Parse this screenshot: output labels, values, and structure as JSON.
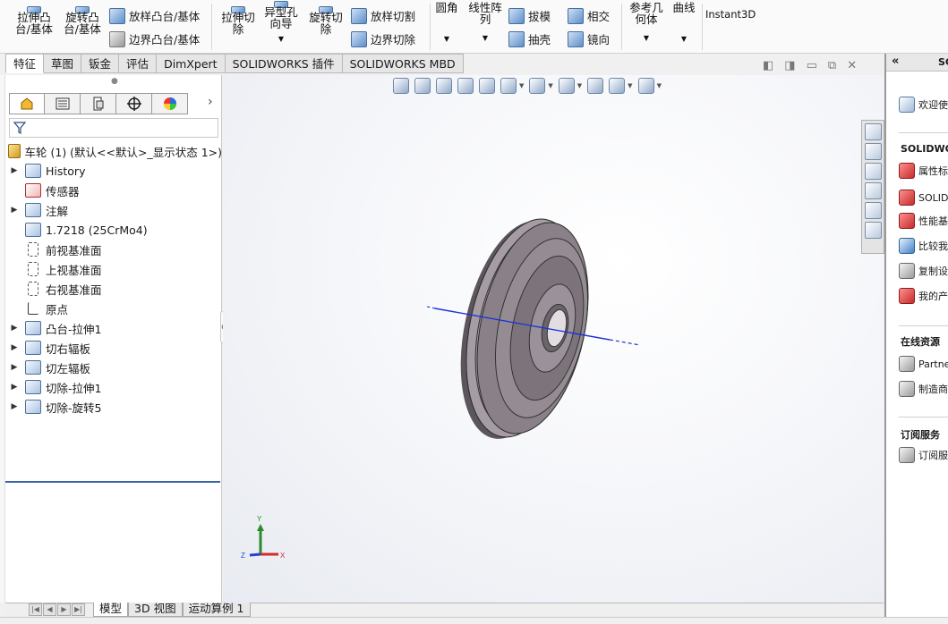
{
  "ribbon": {
    "extrude_boss_l1": "拉伸凸",
    "extrude_boss_l2": "台/基体",
    "revolve_boss_l1": "旋转凸",
    "revolve_boss_l2": "台/基体",
    "loft_boss": "放样凸台/基体",
    "boundary_boss": "边界凸台/基体",
    "extrude_cut_l1": "拉伸切",
    "extrude_cut_l2": "除",
    "hole_wizard_l1": "异型孔",
    "hole_wizard_l2": "向导",
    "revolve_cut_l1": "旋转切",
    "revolve_cut_l2": "除",
    "lofted_cut": "放样切割",
    "boundary_cut": "边界切除",
    "fillet": "圆角",
    "linear_pattern_l1": "线性阵",
    "linear_pattern_l2": "列",
    "draft": "拔模",
    "shell": "抽壳",
    "intersect": "相交",
    "mirror": "镜向",
    "ref_geometry_l1": "参考几",
    "ref_geometry_l2": "何体",
    "curves": "曲线",
    "instant3d": "Instant3D"
  },
  "command_tabs": [
    "特征",
    "草图",
    "钣金",
    "评估",
    "DimXpert",
    "SOLIDWORKS 插件",
    "SOLIDWORKS MBD"
  ],
  "active_command_tab": "特征",
  "window_controls": {
    "prev": "◧",
    "next": "◨",
    "minimize": "▭",
    "restore": "⧉",
    "close": "✕"
  },
  "feature_manager": {
    "tabs_icons": [
      "feature-manager-icon",
      "property-manager-icon",
      "configuration-manager-icon",
      "dimxpert-manager-icon",
      "display-manager-icon"
    ],
    "more": "›",
    "root": "车轮 (1)  (默认<<默认>_显示状态 1>)",
    "items": [
      {
        "label": "History",
        "expandable": true,
        "icon": "history-icon"
      },
      {
        "label": "传感器",
        "expandable": false,
        "icon": "sensor-icon"
      },
      {
        "label": "注解",
        "expandable": true,
        "icon": "annotation-icon"
      },
      {
        "label": "1.7218 (25CrMo4)",
        "expandable": false,
        "icon": "material-icon"
      },
      {
        "label": "前视基准面",
        "expandable": false,
        "icon": "plane-icon"
      },
      {
        "label": "上视基准面",
        "expandable": false,
        "icon": "plane-icon"
      },
      {
        "label": "右视基准面",
        "expandable": false,
        "icon": "plane-icon"
      },
      {
        "label": "原点",
        "expandable": false,
        "icon": "origin-icon"
      },
      {
        "label": "凸台-拉伸1",
        "expandable": true,
        "icon": "boss-extrude-icon"
      },
      {
        "label": "切右辐板",
        "expandable": true,
        "icon": "cut-revolve-icon"
      },
      {
        "label": "切左辐板",
        "expandable": true,
        "icon": "cut-revolve-icon"
      },
      {
        "label": "切除-拉伸1",
        "expandable": true,
        "icon": "cut-extrude-icon"
      },
      {
        "label": "切除-旋转5",
        "expandable": true,
        "icon": "cut-revolve-icon"
      }
    ]
  },
  "triad": {
    "x": "X",
    "y": "Y",
    "z": "Z"
  },
  "bottom_tabs": [
    "模型",
    "3D 视图",
    "运动算例 1"
  ],
  "active_bottom_tab": "模型",
  "task_pane": {
    "title": "SC",
    "collapse": "«",
    "welcome": "欢迎使",
    "section_solidworks": "SOLIDWOF",
    "items_sw": [
      "属性标",
      "SOLID",
      "性能基",
      "比较我",
      "复制设",
      "我的产"
    ],
    "section_online": "在线资源",
    "items_online": [
      "Partne",
      "制造商"
    ],
    "section_subscription": "订阅服务",
    "items_sub": [
      "订阅服"
    ]
  },
  "colors": {
    "accent": "#3a64a8",
    "model_body": "#8a8188",
    "axis_line": "#1f34d6"
  }
}
